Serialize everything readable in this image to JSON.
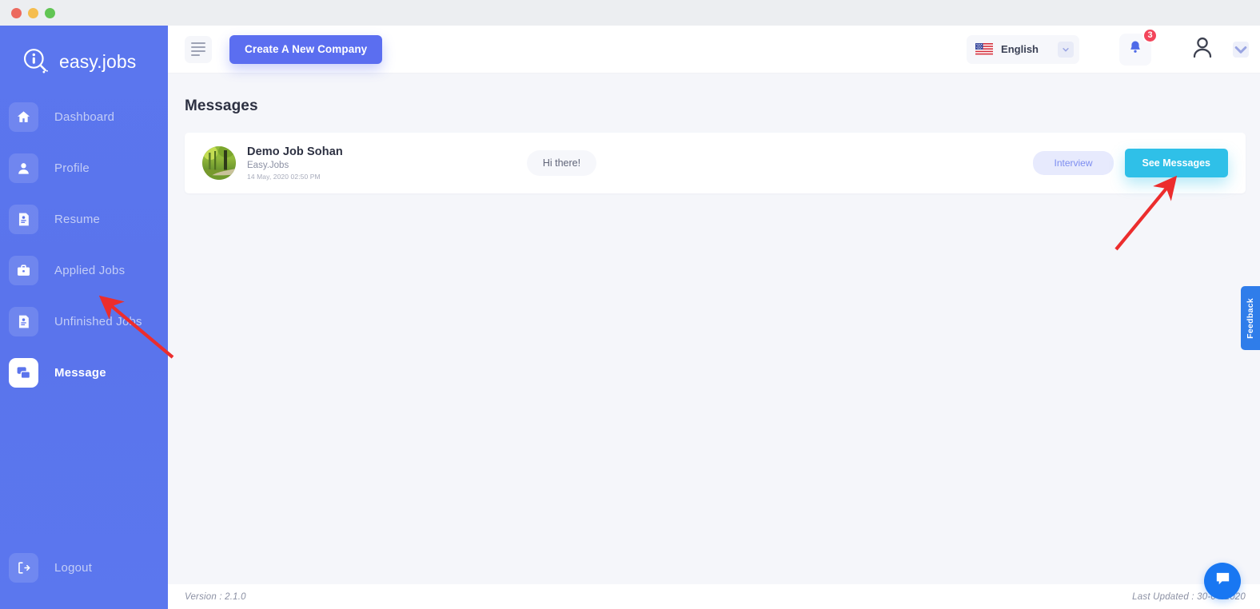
{
  "window": {
    "traffic_lights": [
      "close",
      "minimize",
      "maximize"
    ]
  },
  "sidebar": {
    "brand": "easy.jobs",
    "brand_logo_icon": "magnifier-info-logo-icon",
    "items": [
      {
        "label": "Dashboard",
        "icon": "home-icon",
        "active": false
      },
      {
        "label": "Profile",
        "icon": "user-icon",
        "active": false
      },
      {
        "label": "Resume",
        "icon": "resume-icon",
        "active": false
      },
      {
        "label": "Applied Jobs",
        "icon": "briefcase-icon",
        "active": false
      },
      {
        "label": "Unfinished Jobs",
        "icon": "document-id-icon",
        "active": false
      },
      {
        "label": "Message",
        "icon": "chat-icon",
        "active": true
      }
    ],
    "logout": {
      "label": "Logout",
      "icon": "logout-icon"
    },
    "bg_color": "#5b74ec",
    "active_label_color": "#ffffff",
    "inactive_label_color": "#c3cdf6"
  },
  "header": {
    "menu_toggle_icon": "hamburger-icon",
    "create_company_label": "Create A New Company",
    "create_company_color": "#5b6ef0",
    "language": {
      "value": "English",
      "flag_icon": "us-flag-icon",
      "chevron_icon": "chevron-down-icon"
    },
    "notifications": {
      "icon": "bell-icon",
      "count": "3",
      "badge_color": "#f3455b"
    },
    "account": {
      "icon": "user-avatar-icon",
      "chevron_icon": "chevron-down-icon"
    }
  },
  "main": {
    "page_title": "Messages",
    "message": {
      "avatar_icon": "forest-photo-avatar",
      "name": "Demo Job Sohan",
      "company": "Easy.Jobs",
      "date": "14 May, 2020 02:50 PM",
      "preview": "Hi there!",
      "tag": "Interview",
      "tag_color": "#7d8df0",
      "action_label": "See Messages",
      "action_color": "#2fc0e8"
    }
  },
  "footer": {
    "version": "Version : 2.1.0",
    "last_updated": "Last Updated : 30-04-2020"
  },
  "feedback_tab": {
    "label": "Feedback",
    "color": "#2f7dea"
  },
  "chat_widget": {
    "icon": "messenger-chat-icon",
    "color": "#1877f2"
  },
  "annotations": {
    "arrow_color": "#ec2d2d",
    "arrows": [
      {
        "name": "arrow-to-message-nav",
        "points_to": "Message sidebar item"
      },
      {
        "name": "arrow-to-see-messages",
        "points_to": "See Messages button"
      }
    ]
  }
}
